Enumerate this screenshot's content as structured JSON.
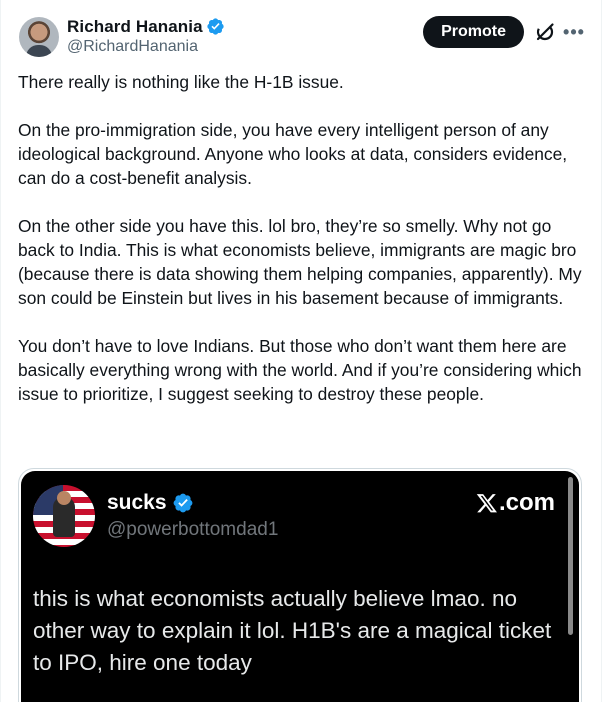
{
  "post": {
    "author": {
      "display_name": "Richard Hanania",
      "handle": "@RichardHanania",
      "verified": true
    },
    "actions": {
      "promote_label": "Promote",
      "grok_icon": "grok-icon",
      "more_icon": "more-icon"
    },
    "paragraphs": [
      "There really is nothing like the H-1B issue.",
      "On the pro-immigration side, you have every intelligent person of any ideological background. Anyone who looks at data, considers evidence, can do a cost-benefit analysis.",
      "On the other side you have this. lol bro, they’re so smelly. Why not go back to India. This is what economists believe, immigrants are magic bro (because there is data showing them helping companies, apparently). My son could be Einstein but lives in his basement because of immigrants.",
      "You don’t have to love Indians. But those who don’t want them here are basically everything wrong with the world. And if you’re considering which issue to prioritize, I suggest seeking to destroy these people."
    ]
  },
  "embed": {
    "display_name": "sucks",
    "handle": "@powerbottomdad1",
    "verified": true,
    "source": ".com",
    "text": "this is what economists actually believe lmao. no other way to explain it lol. H1B's are a magical ticket to IPO, hire one today"
  },
  "colors": {
    "verified_blue": "#1d9bf0",
    "text_primary": "#0f1419",
    "text_secondary": "#536471",
    "embed_bg": "#000000"
  }
}
